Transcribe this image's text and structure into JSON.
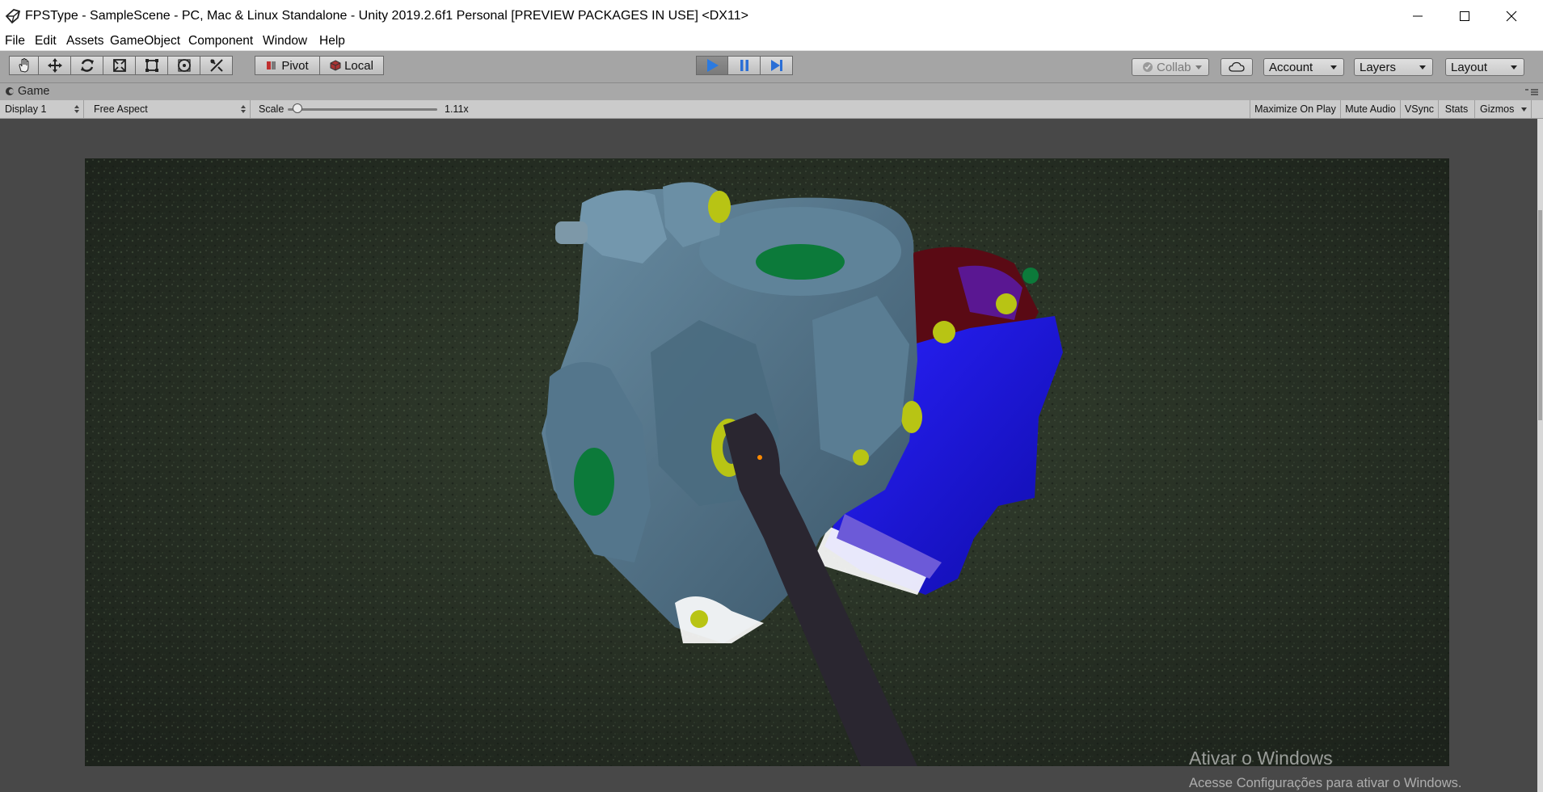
{
  "window": {
    "title": "FPSType - SampleScene - PC, Mac & Linux Standalone - Unity 2019.2.6f1 Personal [PREVIEW PACKAGES IN USE] <DX11>"
  },
  "menu": [
    "File",
    "Edit",
    "Assets",
    "GameObject",
    "Component",
    "Window",
    "Help"
  ],
  "toolbar": {
    "tools": [
      "hand-tool",
      "move-tool",
      "rotate-tool",
      "scale-tool",
      "rect-tool",
      "transform-tool",
      "custom-tool"
    ],
    "pivot_label": "Pivot",
    "local_label": "Local",
    "play_active": true,
    "collab_label": "Collab",
    "account_label": "Account",
    "layers_label": "Layers",
    "layout_label": "Layout"
  },
  "game_view": {
    "tab_label": "Game",
    "display": "Display 1",
    "aspect": "Free Aspect",
    "scale_label": "Scale",
    "scale_value": "1.11x",
    "maximize_on_play": "Maximize On Play",
    "mute_audio": "Mute Audio",
    "vsync": "VSync",
    "stats": "Stats",
    "gizmos": "Gizmos"
  },
  "watermark": {
    "line1": "Ativar o Windows",
    "line2": "Acesse Configurações para ativar o Windows."
  },
  "colors": {
    "play_blue": "#2b6fd6",
    "machine_body": "#4d6f85",
    "blue_part": "#1a14d8",
    "maroon_part": "#5a0a14",
    "yellow_green": "#b8c414",
    "green_part": "#0c7a3a",
    "wrench": "#2a2630"
  }
}
